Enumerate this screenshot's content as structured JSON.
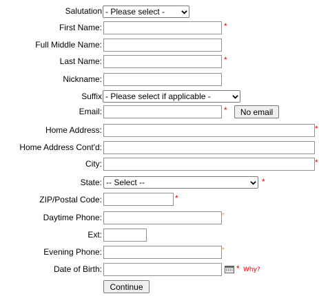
{
  "salutation": {
    "label": "Salutation",
    "value": "- Please select -"
  },
  "first_name": {
    "label": "First Name:",
    "value": ""
  },
  "middle_name": {
    "label": "Full Middle Name:",
    "value": ""
  },
  "last_name": {
    "label": "Last Name:",
    "value": ""
  },
  "nickname": {
    "label": "Nickname:",
    "value": ""
  },
  "suffix": {
    "label": "Suffix",
    "value": "- Please select if applicable -"
  },
  "email": {
    "label": "Email:",
    "value": "",
    "no_email_label": "No email"
  },
  "home_address": {
    "label": "Home Address:",
    "value": ""
  },
  "home_address2": {
    "label": "Home Address Cont'd:",
    "value": ""
  },
  "city": {
    "label": "City:",
    "value": ""
  },
  "state": {
    "label": "State:",
    "value": "-- Select --"
  },
  "zip": {
    "label": "ZIP/Postal Code:",
    "value": ""
  },
  "daytime_phone": {
    "label": "Daytime Phone:",
    "value": ""
  },
  "ext": {
    "label": "Ext:",
    "value": ""
  },
  "evening_phone": {
    "label": "Evening Phone:",
    "value": ""
  },
  "dob": {
    "label": "Date of Birth:",
    "value": "",
    "why_label": "Why?"
  },
  "required_mark": "*",
  "continue_label": "Continue",
  "colors": {
    "required": "#ee0000",
    "optional_mark": "#f0a040",
    "button_bg": "#efefef"
  }
}
